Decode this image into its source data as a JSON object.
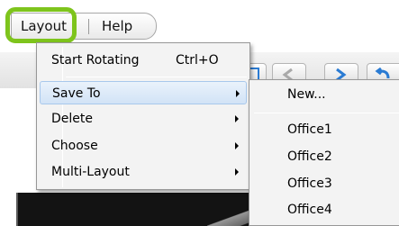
{
  "menubar": {
    "layout_label": "Layout",
    "help_label": "Help"
  },
  "layout_menu": {
    "items": [
      {
        "label": "Start Rotating",
        "shortcut": "Ctrl+O"
      },
      {
        "label": "Save To",
        "submenu": true
      },
      {
        "label": "Delete",
        "submenu": true
      },
      {
        "label": "Choose",
        "submenu": true
      },
      {
        "label": "Multi-Layout",
        "submenu": true
      }
    ]
  },
  "save_to_submenu": {
    "items": [
      "New...",
      "Office1",
      "Office2",
      "Office3",
      "Office4"
    ]
  },
  "colors": {
    "highlight_ring": "#7ec41c",
    "menu_bg": "#f3f3f3",
    "active_item": "#d2e3f6"
  },
  "icons": [
    "layout-icon",
    "arrow-icon",
    "navigate-icon",
    "back-icon",
    "submenu-arrow-icon"
  ]
}
